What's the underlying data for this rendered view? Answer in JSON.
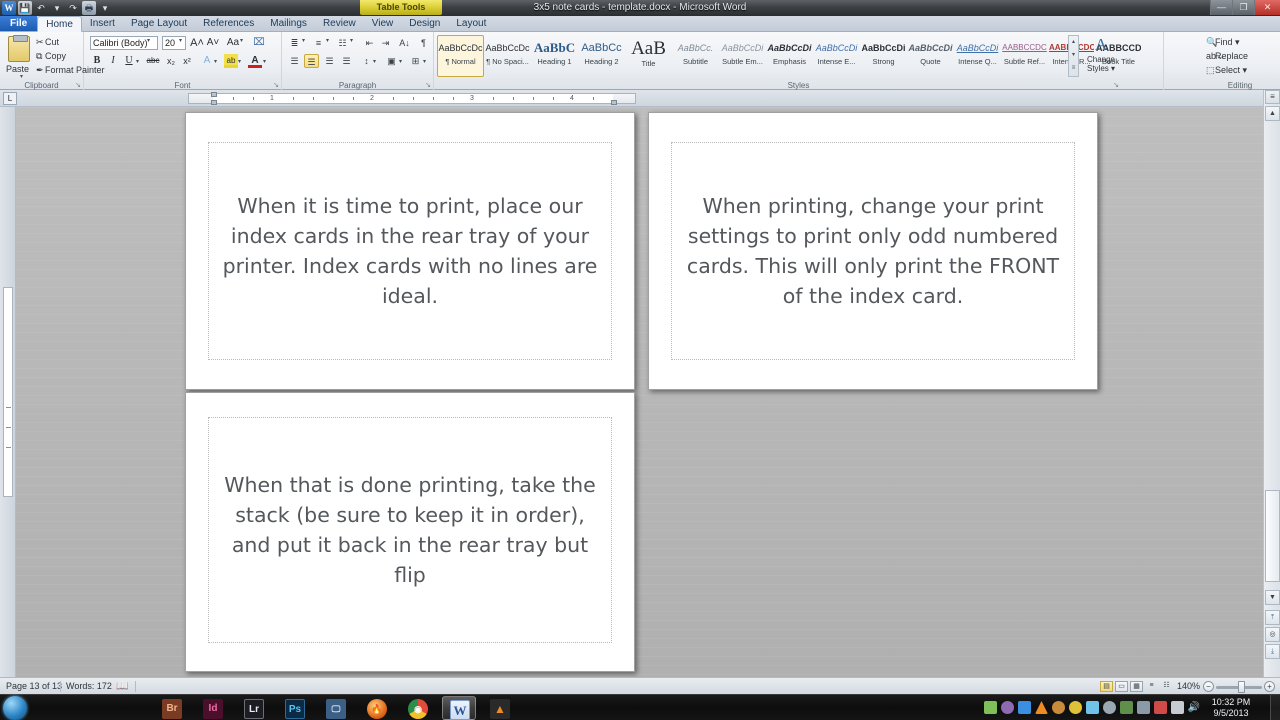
{
  "window": {
    "title": "3x5 note cards - template.docx - Microsoft Word",
    "contextual_tab": "Table Tools",
    "minimize": "—",
    "maximize": "❐",
    "close": "✕"
  },
  "qat": {
    "logo": "W",
    "save": "💾",
    "undo": "↶",
    "undo_arrow": "▾",
    "redo": "↷",
    "print": "🖶",
    "customize": "▾"
  },
  "tabs": [
    {
      "label": "File",
      "state": "file"
    },
    {
      "label": "Home",
      "state": "active"
    },
    {
      "label": "Insert",
      "state": "normal"
    },
    {
      "label": "Page Layout",
      "state": "normal"
    },
    {
      "label": "References",
      "state": "normal"
    },
    {
      "label": "Mailings",
      "state": "normal"
    },
    {
      "label": "Review",
      "state": "normal"
    },
    {
      "label": "View",
      "state": "normal"
    },
    {
      "label": "Design",
      "state": "normal"
    },
    {
      "label": "Layout",
      "state": "normal"
    }
  ],
  "ribbon": {
    "clipboard": {
      "group_label": "Clipboard",
      "paste_label": "Paste",
      "paste_arrow": "▾",
      "cut": "Cut",
      "copy": "Copy",
      "format_painter": "Format Painter",
      "cut_icon": "✂",
      "copy_icon": "⧉",
      "painter_icon": "✒",
      "dialog_launcher": "↘"
    },
    "font": {
      "group_label": "Font",
      "font_name": "Calibri (Body)",
      "font_size": "20",
      "grow_font": "A˄",
      "shrink_font": "A˅",
      "change_case": "Aa",
      "clear_formatting": "⌧",
      "bold": "B",
      "italic": "I",
      "underline": "U",
      "strikethrough": "abc",
      "subscript": "x₂",
      "superscript": "x²",
      "text_effects": "A",
      "highlight": "ab",
      "font_color": "A",
      "arrow": "▾",
      "dialog_launcher": "↘"
    },
    "paragraph": {
      "group_label": "Paragraph",
      "bullets": "≣",
      "numbering": "≡",
      "multilevel": "☷",
      "decrease_indent": "⇤",
      "increase_indent": "⇥",
      "sort": "A↓",
      "show_marks": "¶",
      "align_left": "☰",
      "align_center": "☰",
      "align_right": "☰",
      "justify": "☰",
      "line_spacing": "↕",
      "shading": "▣",
      "borders": "⊞",
      "arrow": "▾",
      "dialog_launcher": "↘"
    },
    "styles": {
      "group_label": "Styles",
      "items": [
        {
          "preview": "AaBbCcDc",
          "name": "¶ Normal",
          "selected": true
        },
        {
          "preview": "AaBbCcDc",
          "name": "¶ No Spaci...",
          "selected": false
        },
        {
          "preview": "AaBbC",
          "name": "Heading 1",
          "selected": false
        },
        {
          "preview": "AaBbCc",
          "name": "Heading 2",
          "selected": false
        },
        {
          "preview": "AaB",
          "name": "Title",
          "selected": false
        },
        {
          "preview": "AaBbCc.",
          "name": "Subtitle",
          "selected": false
        },
        {
          "preview": "AaBbCcDi",
          "name": "Subtle Em...",
          "selected": false
        },
        {
          "preview": "AaBbCcDi",
          "name": "Emphasis",
          "selected": false
        },
        {
          "preview": "AaBbCcDi",
          "name": "Intense E...",
          "selected": false
        },
        {
          "preview": "AaBbCcDi",
          "name": "Strong",
          "selected": false
        },
        {
          "preview": "AaBbCcDi",
          "name": "Quote",
          "selected": false
        },
        {
          "preview": "AaBbCcDi",
          "name": "Intense Q...",
          "selected": false
        },
        {
          "preview": "AABBCCDC",
          "name": "Subtle Ref...",
          "selected": false
        },
        {
          "preview": "AABBCCDC",
          "name": "Intense R...",
          "selected": false
        },
        {
          "preview": "AABBCCDC",
          "name": "Book Title",
          "selected": false
        }
      ],
      "scroll_up": "▴",
      "scroll_down": "▾",
      "more": "≡",
      "change_styles_icon": "A",
      "change_styles_label": "Change Styles ▾",
      "dialog_launcher": "↘"
    },
    "editing": {
      "group_label": "Editing",
      "find": "Find ▾",
      "replace": "Replace",
      "select": "Select ▾",
      "find_icon": "🔍",
      "replace_icon": "ab↔",
      "select_icon": "⬚"
    }
  },
  "ruler": {
    "tab_selector": "L",
    "numbers": [
      "1",
      "2",
      "3",
      "4"
    ]
  },
  "document": {
    "cards": [
      {
        "id": "card-1",
        "text": "When it is time to print, place our index cards in the rear tray of your printer.  Index cards with no lines are ideal."
      },
      {
        "id": "card-2",
        "text": "When printing, change your print settings to print only odd numbered cards.  This will only print the FRONT of the index card."
      },
      {
        "id": "card-3",
        "text": "When that is done printing, take the stack (be sure to keep it in order), and put it back in the rear tray but flip"
      }
    ]
  },
  "scrollbar": {
    "split": "≡",
    "up": "▲",
    "down": "▼",
    "prev_page": "⤒",
    "select_object": "◎",
    "next_page": "⤓"
  },
  "statusbar": {
    "page": "Page 13 of 13",
    "words": "Words: 172",
    "proofing_icon": "📖",
    "zoom": "140%",
    "zoom_out": "−",
    "zoom_in": "+",
    "views": [
      {
        "name": "print-layout",
        "glyph": "▤",
        "active": true
      },
      {
        "name": "full-screen-reading",
        "glyph": "▭",
        "active": false
      },
      {
        "name": "web-layout",
        "glyph": "▦",
        "active": false
      },
      {
        "name": "outline",
        "glyph": "≡",
        "active": false
      },
      {
        "name": "draft",
        "glyph": "☷",
        "active": false
      }
    ]
  },
  "taskbar": {
    "start": "start-orb",
    "items": [
      {
        "name": "adobe-bridge",
        "label": "Br",
        "bg": "#7a3b25",
        "color": "#f2b48c",
        "active": false
      },
      {
        "name": "adobe-indesign",
        "label": "Id",
        "bg": "#4a0f2b",
        "color": "#f06ba8",
        "active": false
      },
      {
        "name": "adobe-lightroom",
        "label": "Lr",
        "bg": "#1c1c22",
        "color": "#e8edf2",
        "active": false
      },
      {
        "name": "adobe-photoshop",
        "label": "Ps",
        "bg": "#0a2a46",
        "color": "#56c5f5",
        "active": false
      },
      {
        "name": "remote-desktop",
        "label": "🖵",
        "bg": "#3c5f86",
        "color": "#dbeaf7",
        "active": false
      },
      {
        "name": "firefox",
        "label": "🔥",
        "bg": "#e06a1b",
        "color": "#ffe9c9",
        "active": false
      },
      {
        "name": "google-chrome",
        "label": "◉",
        "bg": "#2a8d4a",
        "color": "#ffffff",
        "active": false
      },
      {
        "name": "microsoft-word",
        "label": "W",
        "bg": "#2a5699",
        "color": "#ffffff",
        "active": true
      },
      {
        "name": "vlc-media-player",
        "label": "▲",
        "bg": "#2a2a2a",
        "color": "#ef8b22",
        "active": false
      }
    ],
    "tray": [
      {
        "name": "tray-icon-sync",
        "color": "#7fbf5a"
      },
      {
        "name": "tray-icon-shield",
        "color": "#8e6ab0"
      },
      {
        "name": "tray-icon-bluetooth",
        "color": "#3a8fe0"
      },
      {
        "name": "tray-icon-vlc",
        "color": "#ef8b22"
      },
      {
        "name": "tray-icon-sound-alt",
        "color": "#c98b3a"
      },
      {
        "name": "tray-icon-shield-yellow",
        "color": "#e0c23a"
      },
      {
        "name": "tray-icon-sharing",
        "color": "#6fc3e8"
      },
      {
        "name": "tray-icon-cloud",
        "color": "#9aa6b2"
      },
      {
        "name": "tray-icon-battery",
        "color": "#5f8f4a"
      },
      {
        "name": "tray-icon-backup",
        "color": "#8a9aa8"
      },
      {
        "name": "tray-icon-flag",
        "color": "#d04a4a"
      },
      {
        "name": "tray-icon-network",
        "color": "#c6ccd2"
      }
    ],
    "volume_icon": "🔊",
    "signal_icon": "▮▮▮",
    "time": "10:32 PM",
    "date": "9/5/2013"
  }
}
